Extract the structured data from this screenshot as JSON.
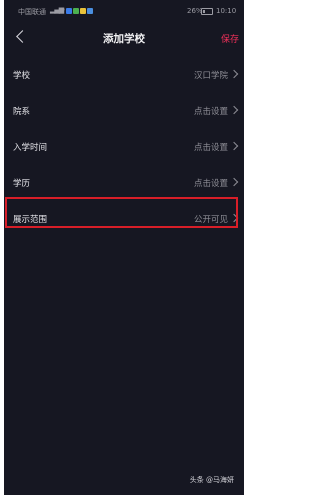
{
  "status_bar": {
    "carrier": "中国联通",
    "battery": "26%",
    "time": "10:10"
  },
  "nav": {
    "title": "添加学校",
    "save_label": "保存"
  },
  "rows": [
    {
      "label": "学校",
      "value": "汉口学院"
    },
    {
      "label": "院系",
      "value": "点击设置"
    },
    {
      "label": "入学时间",
      "value": "点击设置"
    },
    {
      "label": "学历",
      "value": "点击设置"
    },
    {
      "label": "展示范围",
      "value": "公开可见"
    }
  ],
  "watermark": "头条 @马海妍",
  "colors": {
    "background": "#161722",
    "accent": "#f0305a",
    "highlight": "#d81e28"
  },
  "icons": {
    "back": "chevron-left-icon",
    "row_arrow": "chevron-right-icon"
  }
}
